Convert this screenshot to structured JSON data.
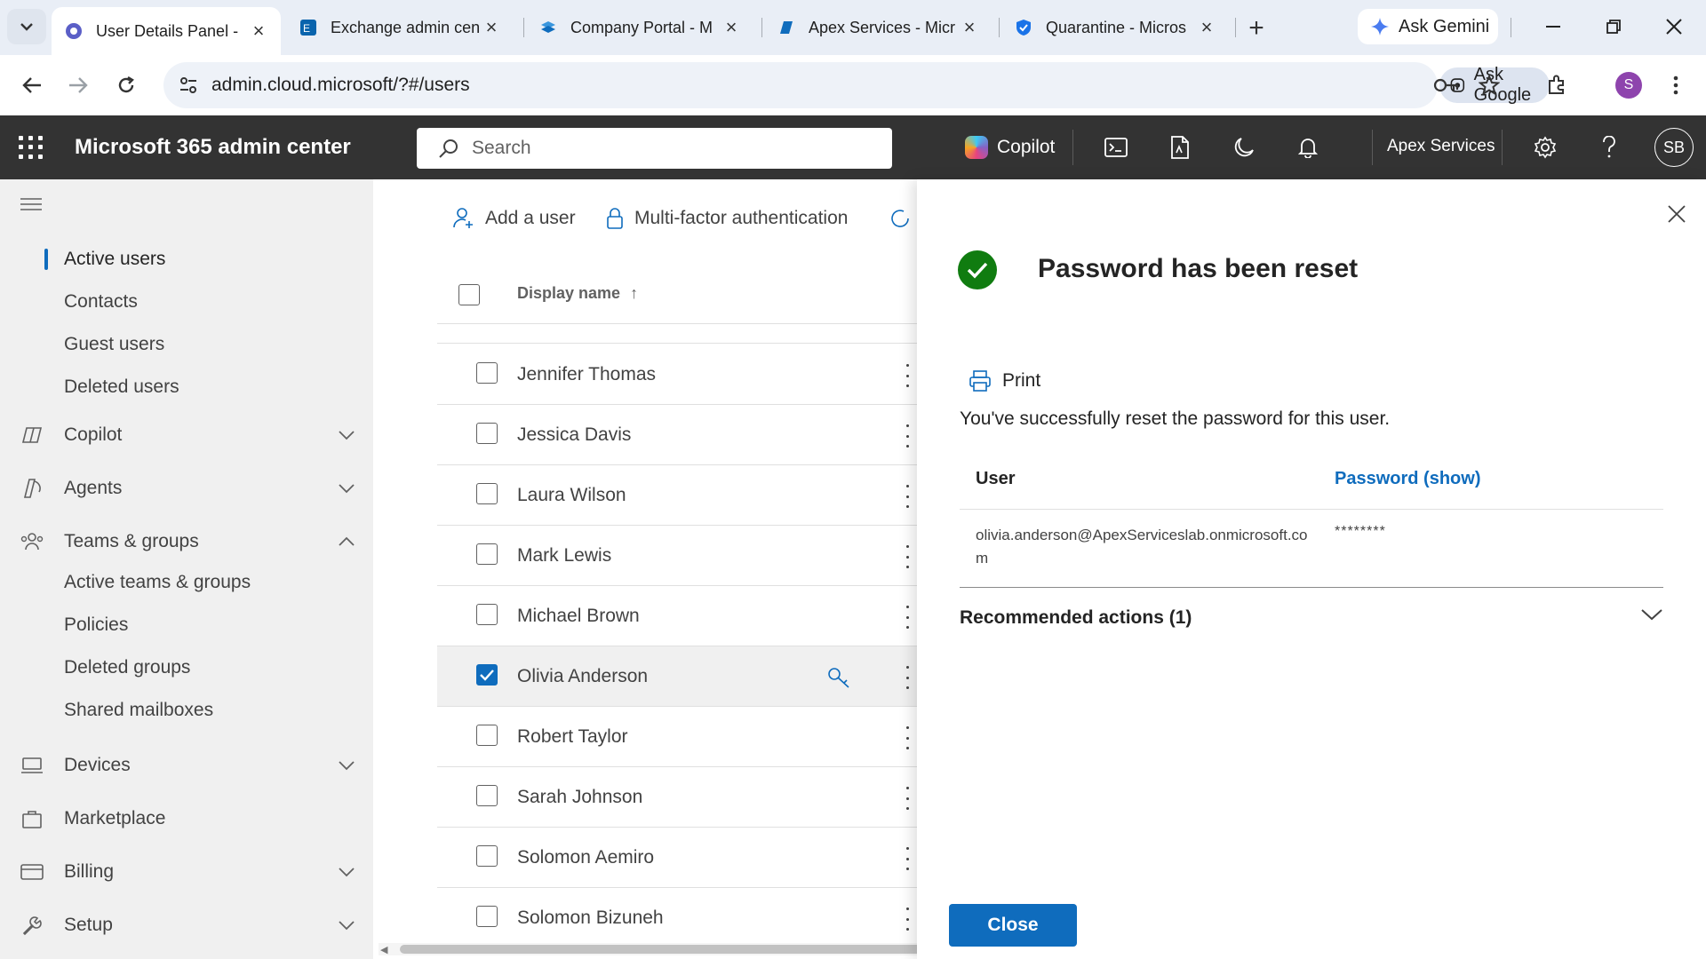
{
  "browser": {
    "tabs": [
      {
        "title": "User Details Panel - ",
        "active": true,
        "favicon": "m365-gear-icon"
      },
      {
        "title": "Exchange admin cen",
        "active": false,
        "favicon": "exchange-icon"
      },
      {
        "title": "Company Portal - M",
        "active": false,
        "favicon": "company-portal-icon"
      },
      {
        "title": "Apex Services - Micr",
        "active": false,
        "favicon": "sharepoint-icon"
      },
      {
        "title": "Quarantine - Micros",
        "active": false,
        "favicon": "defender-shield-icon"
      }
    ],
    "gemini_label": "Ask Gemini",
    "url": "admin.cloud.microsoft/?#/users",
    "ask_google_label": "Ask Google",
    "profile_initial": "S"
  },
  "header": {
    "app_title": "Microsoft 365 admin center",
    "search_placeholder": "Search",
    "copilot_label": "Copilot",
    "org_name": "Apex Services",
    "user_initials": "SB"
  },
  "leftnav": {
    "users_sub": [
      {
        "label": "Active users",
        "active": true
      },
      {
        "label": "Contacts"
      },
      {
        "label": "Guest users"
      },
      {
        "label": "Deleted users"
      }
    ],
    "copilot": "Copilot",
    "agents": "Agents",
    "teams_groups": "Teams & groups",
    "teams_sub": [
      "Active teams & groups",
      "Policies",
      "Deleted groups",
      "Shared mailboxes"
    ],
    "devices": "Devices",
    "marketplace": "Marketplace",
    "billing": "Billing",
    "setup": "Setup"
  },
  "toolbar": {
    "add_user": "Add a user",
    "mfa": "Multi-factor authentication"
  },
  "list": {
    "col_display_name": "Display name",
    "sort": "ascending",
    "rows": [
      {
        "name": "Jennifer Thomas",
        "selected": false
      },
      {
        "name": "Jessica Davis",
        "selected": false
      },
      {
        "name": "Laura Wilson",
        "selected": false
      },
      {
        "name": "Mark Lewis",
        "selected": false
      },
      {
        "name": "Michael Brown",
        "selected": false
      },
      {
        "name": "Olivia Anderson",
        "selected": true
      },
      {
        "name": "Robert Taylor",
        "selected": false
      },
      {
        "name": "Sarah Johnson",
        "selected": false
      },
      {
        "name": "Solomon Aemiro",
        "selected": false
      },
      {
        "name": "Solomon Bizuneh",
        "selected": false
      }
    ]
  },
  "panel": {
    "title": "Password has been reset",
    "print_label": "Print",
    "message": "You've successfully reset the password for this user.",
    "table_user_header": "User",
    "table_password_header": "Password (show)",
    "user_email": "olivia.anderson@ApexServiceslab.onmicrosoft.com",
    "password_masked": "********",
    "recommended_actions": "Recommended actions (1)",
    "close_label": "Close"
  },
  "colors": {
    "accent": "#0f6cbd",
    "success": "#107c10",
    "header_bg": "#333333",
    "nav_bg": "#f0f0f0"
  }
}
